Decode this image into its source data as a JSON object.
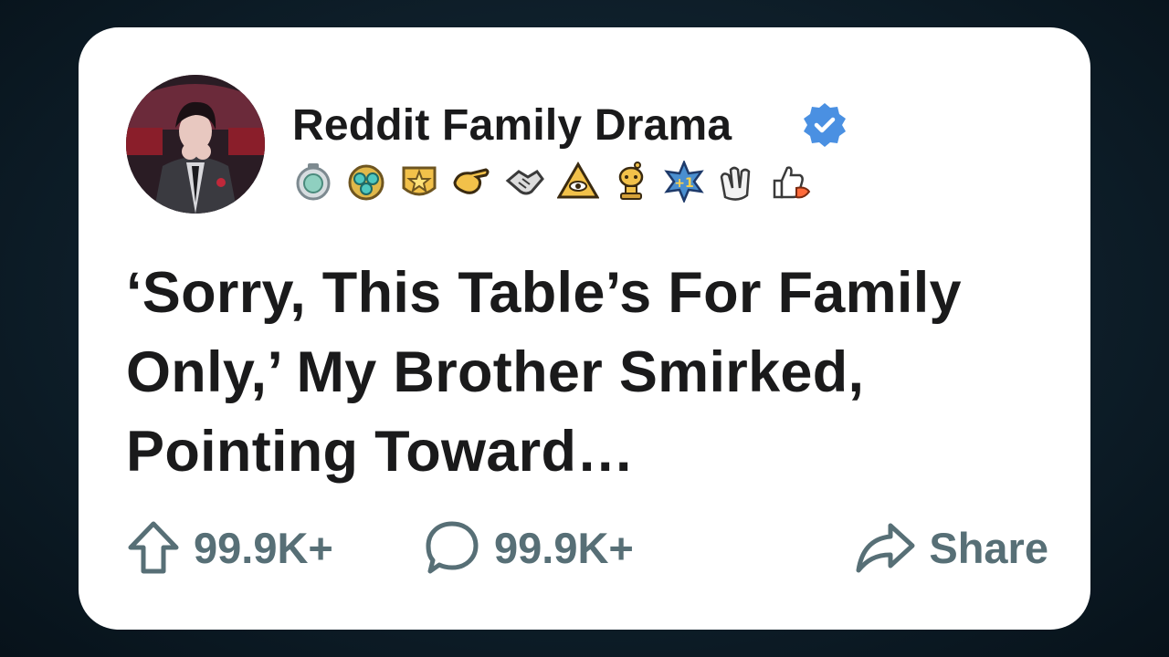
{
  "post": {
    "author": "Reddit Family Drama",
    "verified_icon": "verified-badge-icon",
    "verified_color": "#4a90e2",
    "avatar_icon": "avatar-illustration",
    "awards": [
      "silver-award-icon",
      "gem-award-icon",
      "gold-star-award-icon",
      "pointing-hand-award-icon",
      "handshake-award-icon",
      "eye-pyramid-award-icon",
      "snoo-trophy-award-icon",
      "plus-one-award-icon",
      "clap-award-icon",
      "thumbs-up-rocket-award-icon"
    ],
    "title": "‘Sorry, This Table’s For Family Only,’ My Brother Smirked, Pointing Toward…"
  },
  "actions": {
    "upvote_icon": "upvote-arrow-icon",
    "upvote_count": "99.9K+",
    "comment_icon": "comment-bubble-icon",
    "comment_count": "99.9K+",
    "share_icon": "share-arrow-icon",
    "share_label": "Share"
  },
  "colors": {
    "text": "#1a1a1b",
    "muted": "#576f76",
    "card": "#ffffff"
  }
}
